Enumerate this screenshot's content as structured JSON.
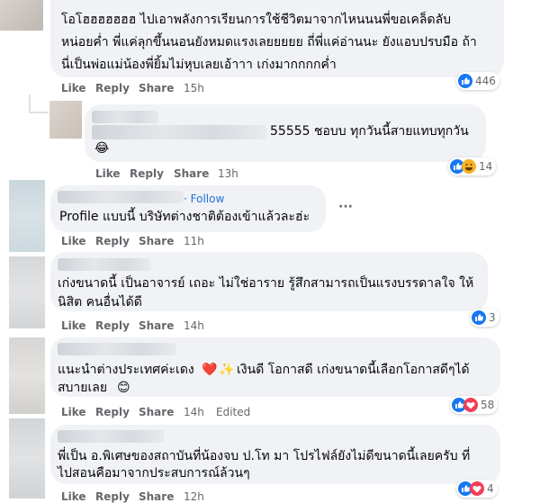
{
  "comments": [
    {
      "text_lines": [
        "โอโฮฮฮฮฮฮฮ ไปเอาพลังการเรียนการใช้ชีวิตมาจากไหนนนพี่ขอเคล็ดลับ",
        "หน่อยค่ำ พี่แค่ลุกขึ้นนอนยังหมดแรงเลยยยยย ถี่พี่แค่อ่านนะ ยังแอบปรบมือ ถ้า",
        "นี่เป็นพ่อแม่น้องพี่ยิ้มไม่หุบเลยเอ้าาา เก่งมากกกกค่ำ"
      ],
      "like": "Like",
      "reply": "Reply",
      "share": "Share",
      "time": "15h",
      "reaction_count": "446"
    },
    {
      "text_line": "55555 ชอบบ ทุกวันนี้สายแทบทุกวัน",
      "emoji": "😂",
      "like": "Like",
      "reply": "Reply",
      "share": "Share",
      "time": "13h",
      "reaction_count": "14"
    },
    {
      "follow": "Follow",
      "text_line": "Profile แบบนี้ บริษัทต่างชาติต้องเข้าแล้วละฮ่ะ",
      "more": "···",
      "like": "Like",
      "reply": "Reply",
      "share": "Share",
      "time": "11h"
    },
    {
      "text_lines": [
        "เก่งขนาดนี้ เป็นอาจารย์ เถอะ ไม่ใช่อาราย รู้สึกสามารถเป็นแรงบรรดาลใจ ให้",
        "นิสิต คนอื่นได้ดี"
      ],
      "like": "Like",
      "reply": "Reply",
      "share": "Share",
      "time": "14h",
      "reaction_count": "3"
    },
    {
      "text_lines": [
        "แนะนำต่างประเทศค่ะเดง",
        "สบายเลย"
      ],
      "text_line1_rest": "เงินดี โอกาสดี เก่งขนาดนี้เลือกโอกาสดีๆได้",
      "emoji_heart": "❤️",
      "emoji_sparkle": "✨",
      "emoji_smile": "😊",
      "like": "Like",
      "reply": "Reply",
      "share": "Share",
      "time": "14h",
      "edited": "Edited",
      "reaction_count": "58"
    },
    {
      "text_lines": [
        "พี่เป็น อ.พิเศษของสถาบันที่น้องจบ ป.โท มา โปรไฟล์ยังไม่ดีขนาดนี้เลยครับ ที่",
        "ไปสอนคือมาจากประสบการณ์ล้วนๆ"
      ],
      "like": "Like",
      "reply": "Reply",
      "share": "Share",
      "time": "12h",
      "reaction_count": "4"
    }
  ],
  "colors": {
    "like_blue": "#1877f2",
    "love_red": "#f33e58",
    "haha_yellow": "#f7b125",
    "follow_blue": "#216fdb"
  }
}
